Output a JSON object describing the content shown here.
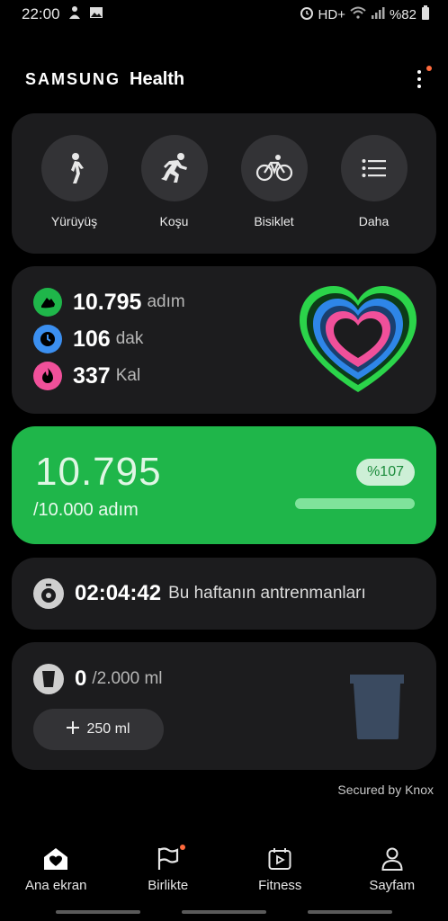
{
  "status_bar": {
    "time": "22:00",
    "network": "HD+",
    "battery": "%82"
  },
  "header": {
    "brand_samsung": "SAMSUNG",
    "brand_health": "Health"
  },
  "activities": [
    {
      "label": "Yürüyüş",
      "icon": "walking-icon"
    },
    {
      "label": "Koşu",
      "icon": "running-icon"
    },
    {
      "label": "Bisiklet",
      "icon": "bicycle-icon"
    },
    {
      "label": "Daha",
      "icon": "list-icon"
    }
  ],
  "summary": {
    "steps_value": "10.795",
    "steps_unit": "adım",
    "active_value": "106",
    "active_unit": "dak",
    "calories_value": "337",
    "calories_unit": "Kal",
    "colors": {
      "steps": "#1fb64a",
      "active": "#3b8ff0",
      "calories": "#f0509a"
    }
  },
  "steps": {
    "count": "10.795",
    "goal_text": "/10.000 adım",
    "percent_text": "%107",
    "progress_fraction": 1.0
  },
  "workout": {
    "time": "02:04:42",
    "label": "Bu haftanın antrenmanları"
  },
  "water": {
    "value": "0",
    "goal": "/2.000 ml",
    "add_label": "250 ml"
  },
  "footer": {
    "secured": "Secured by Knox"
  },
  "nav": [
    {
      "label": "Ana ekran",
      "icon": "home-heart-icon"
    },
    {
      "label": "Birlikte",
      "icon": "flag-icon"
    },
    {
      "label": "Fitness",
      "icon": "calendar-play-icon"
    },
    {
      "label": "Sayfam",
      "icon": "person-icon"
    }
  ]
}
